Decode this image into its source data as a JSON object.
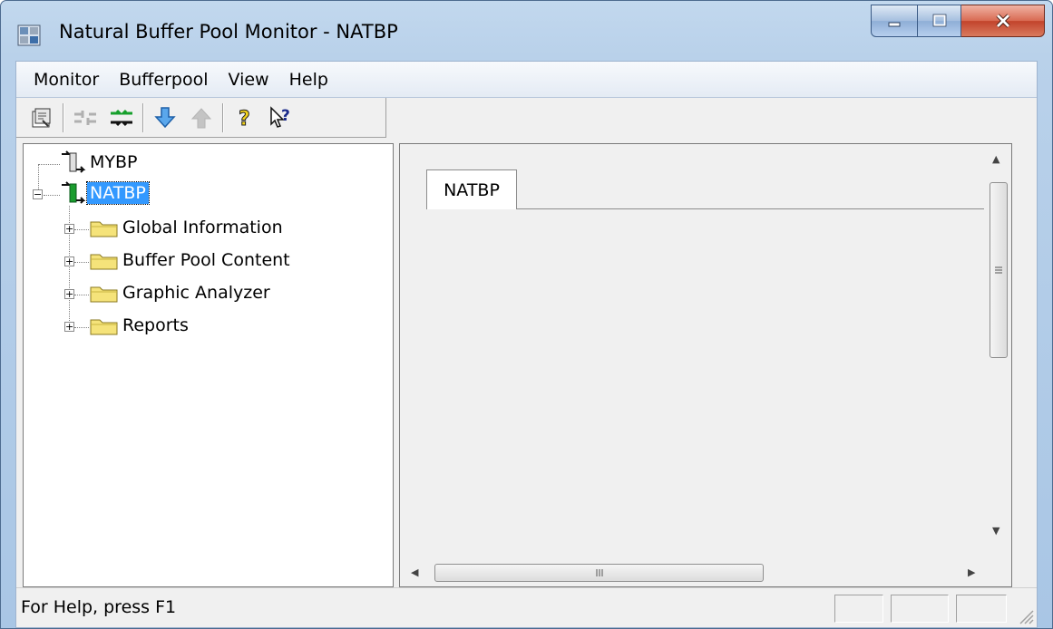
{
  "window": {
    "title": "Natural Buffer Pool Monitor - NATBP",
    "caption_buttons": {
      "minimize": "minimize",
      "maximize": "maximize",
      "close": "close"
    }
  },
  "menubar": {
    "items": [
      {
        "label": "Monitor"
      },
      {
        "label": "Bufferpool"
      },
      {
        "label": "View"
      },
      {
        "label": "Help"
      }
    ]
  },
  "toolbar": {
    "buttons": [
      {
        "icon": "properties-icon",
        "enabled": true
      },
      {
        "icon": "disconnect-icon",
        "enabled": false
      },
      {
        "icon": "connect-icon",
        "enabled": true
      },
      {
        "icon": "arrow-down-icon",
        "enabled": true
      },
      {
        "icon": "arrow-up-icon",
        "enabled": false
      },
      {
        "icon": "help-icon",
        "enabled": true
      },
      {
        "icon": "context-help-icon",
        "enabled": true
      }
    ]
  },
  "tree": {
    "nodes": [
      {
        "label": "MYBP",
        "icon": "bufferpool-disconnected-icon"
      },
      {
        "label": "NATBP",
        "icon": "bufferpool-connected-icon",
        "selected": true,
        "expanded": true,
        "children": [
          {
            "label": "Global Information",
            "icon": "folder-icon"
          },
          {
            "label": "Buffer Pool Content",
            "icon": "folder-icon"
          },
          {
            "label": "Graphic Analyzer",
            "icon": "folder-icon"
          },
          {
            "label": "Reports",
            "icon": "folder-icon"
          }
        ]
      }
    ]
  },
  "content": {
    "tabs": [
      {
        "label": "NATBP",
        "active": true
      }
    ]
  },
  "statusbar": {
    "text": "For Help, press F1"
  },
  "colors": {
    "selection": "#3399ff",
    "folder": "#f5e37a",
    "connected": "#1a9c2e",
    "arrow": "#2b7fd9"
  }
}
